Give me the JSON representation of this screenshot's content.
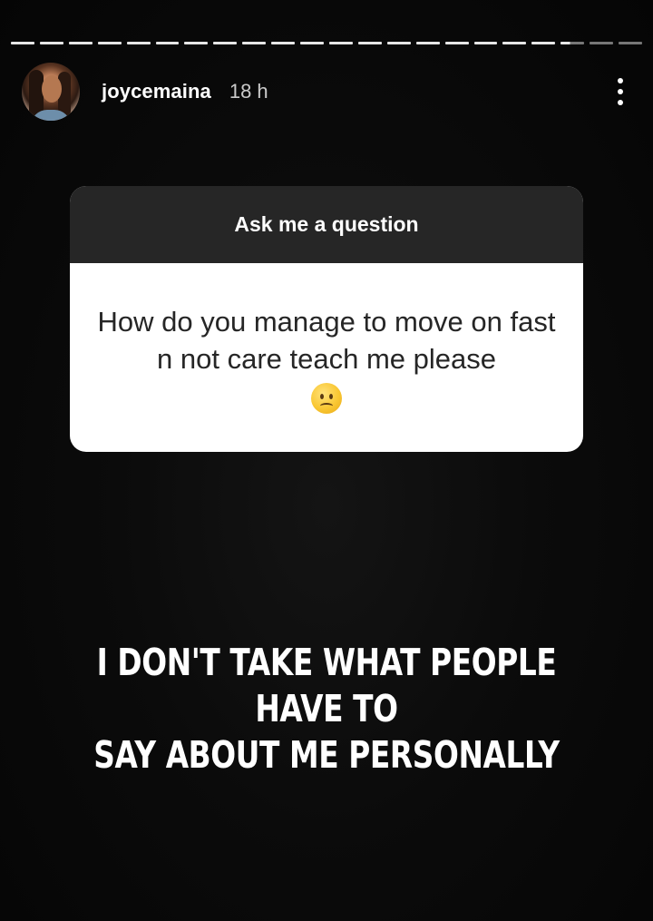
{
  "story": {
    "segments": {
      "total": 22,
      "seen": 19,
      "current_progress": 0.4
    },
    "user": {
      "username": "joycemaina",
      "time_ago": "18 h",
      "avatar_icon": "avatar-photo"
    },
    "menu_icon": "more-vertical-icon"
  },
  "question_sticker": {
    "title": "Ask me a question",
    "question": "How do you manage to move on fast n not care teach me please",
    "emoji": "frowning-face-emoji",
    "header_color": "#262626",
    "body_color": "#ffffff"
  },
  "caption": {
    "text": "I DON'T TAKE WHAT PEOPLE HAVE TO\nSAY ABOUT ME PERSONALLY"
  }
}
